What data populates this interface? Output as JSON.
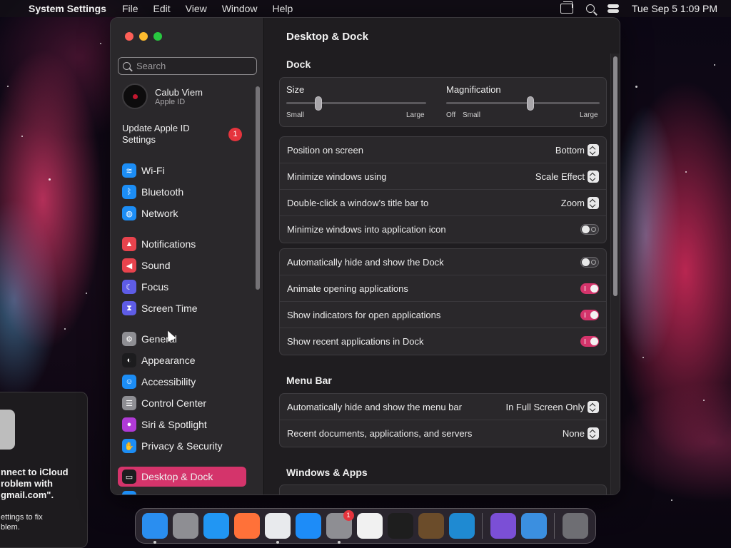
{
  "menubar": {
    "app_name": "System Settings",
    "items": [
      "File",
      "Edit",
      "View",
      "Window",
      "Help"
    ],
    "clock": "Tue Sep 5  1:09 PM"
  },
  "notification_panel": {
    "title": "nnect to iCloud\nroblem with\ngmail.com\".",
    "body": "ettings to fix\nblem."
  },
  "sidebar": {
    "search_placeholder": "Search",
    "account": {
      "name": "Calub Viem",
      "sub": "Apple ID"
    },
    "update": {
      "label": "Update Apple ID\nSettings",
      "badge": "1"
    },
    "items": [
      {
        "label": "Wi-Fi",
        "icon": "wifi-icon",
        "color": "#1c8df5"
      },
      {
        "label": "Bluetooth",
        "icon": "bluetooth-icon",
        "color": "#1c8df5"
      },
      {
        "label": "Network",
        "icon": "globe-icon",
        "color": "#1c8df5"
      },
      {
        "label": "Notifications",
        "icon": "bell-icon",
        "color": "#e8434d"
      },
      {
        "label": "Sound",
        "icon": "speaker-icon",
        "color": "#e8434d"
      },
      {
        "label": "Focus",
        "icon": "moon-icon",
        "color": "#5e5ce6"
      },
      {
        "label": "Screen Time",
        "icon": "hourglass-icon",
        "color": "#5e5ce6"
      },
      {
        "label": "General",
        "icon": "gear-icon",
        "color": "#8e8e93"
      },
      {
        "label": "Appearance",
        "icon": "appearance-icon",
        "color": "#1c1c1e"
      },
      {
        "label": "Accessibility",
        "icon": "accessibility-icon",
        "color": "#1c8df5"
      },
      {
        "label": "Control Center",
        "icon": "control-center-icon",
        "color": "#8e8e93"
      },
      {
        "label": "Siri & Spotlight",
        "icon": "siri-icon",
        "color": "#b03ad6"
      },
      {
        "label": "Privacy & Security",
        "icon": "hand-icon",
        "color": "#1c8df5"
      },
      {
        "label": "Desktop & Dock",
        "icon": "dock-icon",
        "color": "#1c1c1e"
      },
      {
        "label": "Displays",
        "icon": "display-icon",
        "color": "#1c8df5"
      }
    ]
  },
  "content": {
    "title": "Desktop & Dock",
    "dock_section": {
      "title": "Dock",
      "size": {
        "label": "Size",
        "min_label": "Small",
        "max_label": "Large",
        "value": 0.23
      },
      "magnification": {
        "label": "Magnification",
        "off_label": "Off",
        "min_label": "Small",
        "max_label": "Large",
        "value": 0.55
      },
      "settings": [
        {
          "label": "Position on screen",
          "value": "Bottom"
        },
        {
          "label": "Minimize windows using",
          "value": "Scale Effect"
        },
        {
          "label": "Double-click a window's title bar to",
          "value": "Zoom"
        },
        {
          "label": "Minimize windows into application icon",
          "toggle": false
        }
      ],
      "toggles": [
        {
          "label": "Automatically hide and show the Dock",
          "on": false
        },
        {
          "label": "Animate opening applications",
          "on": true
        },
        {
          "label": "Show indicators for open applications",
          "on": true
        },
        {
          "label": "Show recent applications in Dock",
          "on": true
        }
      ]
    },
    "menubar_section": {
      "title": "Menu Bar",
      "settings": [
        {
          "label": "Automatically hide and show the menu bar",
          "value": "In Full Screen Only"
        },
        {
          "label": "Recent documents, applications, and servers",
          "value": "None"
        }
      ]
    },
    "windows_section": {
      "title": "Windows & Apps"
    }
  },
  "dock": {
    "apps": [
      {
        "name": "finder-icon",
        "color": "#2a8ef0",
        "running": true
      },
      {
        "name": "launchpad-icon",
        "color": "#8e8e93",
        "running": false
      },
      {
        "name": "safari-icon",
        "color": "#2196f3",
        "running": false
      },
      {
        "name": "firefox-icon",
        "color": "#ff7139",
        "running": false
      },
      {
        "name": "chrome-icon",
        "color": "#e8eaed",
        "running": true
      },
      {
        "name": "app-store-icon",
        "color": "#1d8cf8",
        "running": false
      },
      {
        "name": "system-settings-icon",
        "color": "#8e8e93",
        "running": true,
        "badge": "1"
      },
      {
        "name": "textedit-icon",
        "color": "#f1f1f1",
        "running": false
      },
      {
        "name": "terminal-icon",
        "color": "#1e1e1e",
        "running": false
      },
      {
        "name": "instruments-icon",
        "color": "#6b4c2a",
        "running": false
      },
      {
        "name": "vscode-icon",
        "color": "#1f8ad2",
        "running": false
      },
      {
        "name": "visual-studio-icon",
        "color": "#7b4fd6",
        "running": false
      },
      {
        "name": "weather-icon",
        "color": "#3b8fe0",
        "running": false
      },
      {
        "name": "trash-icon",
        "color": "#6e6e73",
        "running": false
      }
    ]
  }
}
